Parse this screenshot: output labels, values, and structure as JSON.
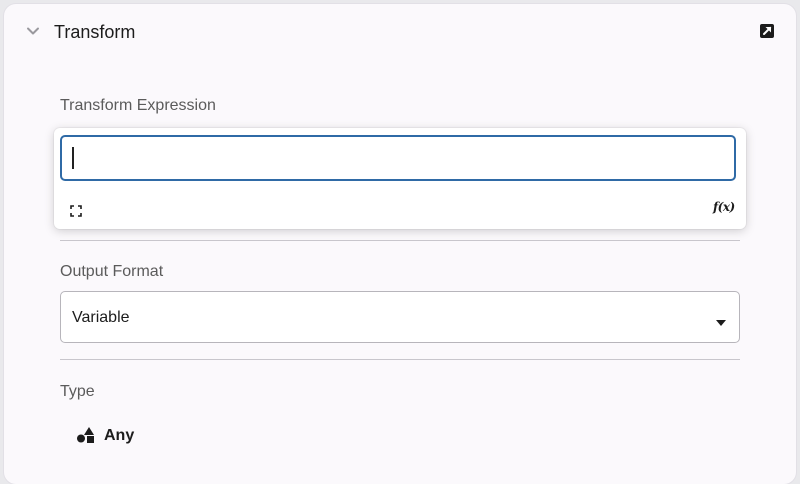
{
  "panel": {
    "title": "Transform",
    "collapse_icon": "chevron-down-icon",
    "popout_icon": "open-in-new-icon"
  },
  "transform_expression": {
    "label": "Transform Expression",
    "value": "",
    "expand_icon": "expand-icon",
    "function_icon": "function-icon",
    "function_label": "f(x)"
  },
  "output_format": {
    "label": "Output Format",
    "selected": "Variable",
    "dropdown_icon": "caret-down-icon"
  },
  "type": {
    "label": "Type",
    "value": "Any",
    "icon": "shapes-icon"
  },
  "colors": {
    "accent": "#2f6aa6",
    "panel_bg": "#fbf9fc",
    "text": "#1c1c1c",
    "label": "#5b5b5b"
  }
}
